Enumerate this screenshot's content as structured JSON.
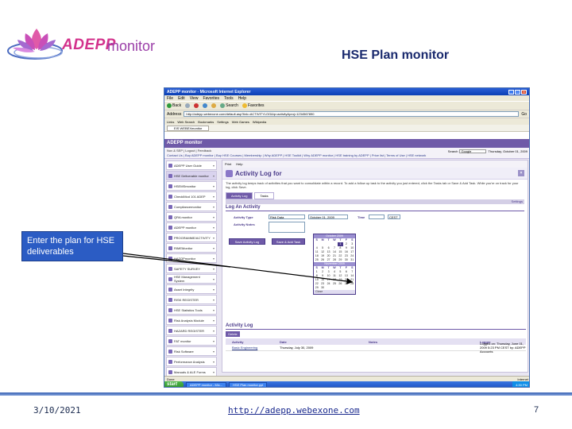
{
  "slide": {
    "logo_text": "ADEPP",
    "logo_suffix": "monitor",
    "title": "HSE Plan monitor",
    "callout": "Enter the plan for HSE deliverables",
    "footer_date": "3/10/2021",
    "footer_url": "http://adepp.webexone.com",
    "page_number": "7"
  },
  "browser": {
    "window_title": "ADEPP monitor - Microsoft Internet Explorer",
    "menu": [
      "File",
      "Edit",
      "View",
      "Favorites",
      "Tools",
      "Help"
    ],
    "toolbar": {
      "back": "Back",
      "search": "Search",
      "favorites": "Favorites"
    },
    "address_label": "Address",
    "address": "http://adepp.webexone.com/default.asp?link=ACTIVITYLOG&ip=activity&proj=1234567890",
    "go_label": "Go",
    "links_label": "Links",
    "links": [
      "Web Search",
      "Bookmarks",
      "Settings",
      "Web Games",
      "Wikipedia"
    ],
    "tab": "EIS WEBEXmonitor",
    "status_left": "Done",
    "status_right": "Internet"
  },
  "app": {
    "header": "ADEPP monitor",
    "user_line": "Nov & SEP | Logout | Feedback",
    "nav": "Contact Us | Buy ADEPP monitor | Buy HSE Courses | Membership | Why ADEPP | HSE Toolkit | Why ADEPP monitor | HSE training by ADEPP | Price list | Terms of Use | HSE network",
    "search_label": "Search",
    "search_value": "Google",
    "date": "Thursday, October 01, 2009",
    "sidebar": [
      "ADEPP User Guide",
      "HSE Deliverable monitor",
      "HSEMSmonitor",
      "ChecklMod 101 ADEP",
      "Compliancemonitor",
      "QRA monitor",
      "ADEPP monitor",
      "PROGRAMME/ACTIVITY",
      "RIMEMonitor",
      "HAZOPmonitor",
      "SAFETY SURVEY",
      "HSE Management System",
      "Asset Integrity",
      "RISK REGISTER",
      "HSE Statistics Tools",
      "Risk Analysis Module",
      "HAZARD REGISTER",
      "FAT monitor",
      "Risk Software",
      "Performance Analysis",
      "Manuals & ALE Forms",
      "Tasks",
      "Documents",
      "Contacts",
      "MY ADEPP"
    ],
    "print_labels": [
      "Print",
      "Help"
    ],
    "page_heading": "Activity Log for",
    "intro": "The activity log keeps track of activities that you want to consolidate within a record. To add a follow up task to the activity you just entered, click the Tasks tab or Save & Add Task. While you're on track for your log, click Save.",
    "subtabs": [
      "Activity Log",
      "Tasks"
    ],
    "settings_label": "Settings",
    "section_heading": "Log An Activity",
    "form": {
      "activity_label": "Activity Type",
      "activity_value": "Risk Data",
      "date_value": "October 01, 2009",
      "time_label": "Time",
      "zone_value": "CEST",
      "notes_label": "Activity Notes",
      "save_log": "Save Activity Log",
      "save_task": "Save & Add Task"
    },
    "calendar_months": [
      "October 2009",
      "November 2009"
    ],
    "calendar_dow": [
      "S",
      "M",
      "T",
      "W",
      "T",
      "F",
      "S"
    ],
    "calendar_close": "Close",
    "table_button": "Delete",
    "activity_list_heading": "Activity Log",
    "table_headers": [
      "",
      "Activity",
      "Date",
      "Notes",
      "Logger"
    ],
    "table_rows": [
      [
        "",
        "Basic Engineering",
        "Thursday, July 30, 2009",
        "",
        "Logged on: Thursday, June 01, 2009 5:23 PM CEST by: ADEPP Accounts"
      ]
    ]
  },
  "taskbar": {
    "start": "start",
    "tasks": [
      "ADEPP monitor - Mic...",
      "HSE Plan monitor.ppt"
    ],
    "clock": "4:30 PM"
  }
}
